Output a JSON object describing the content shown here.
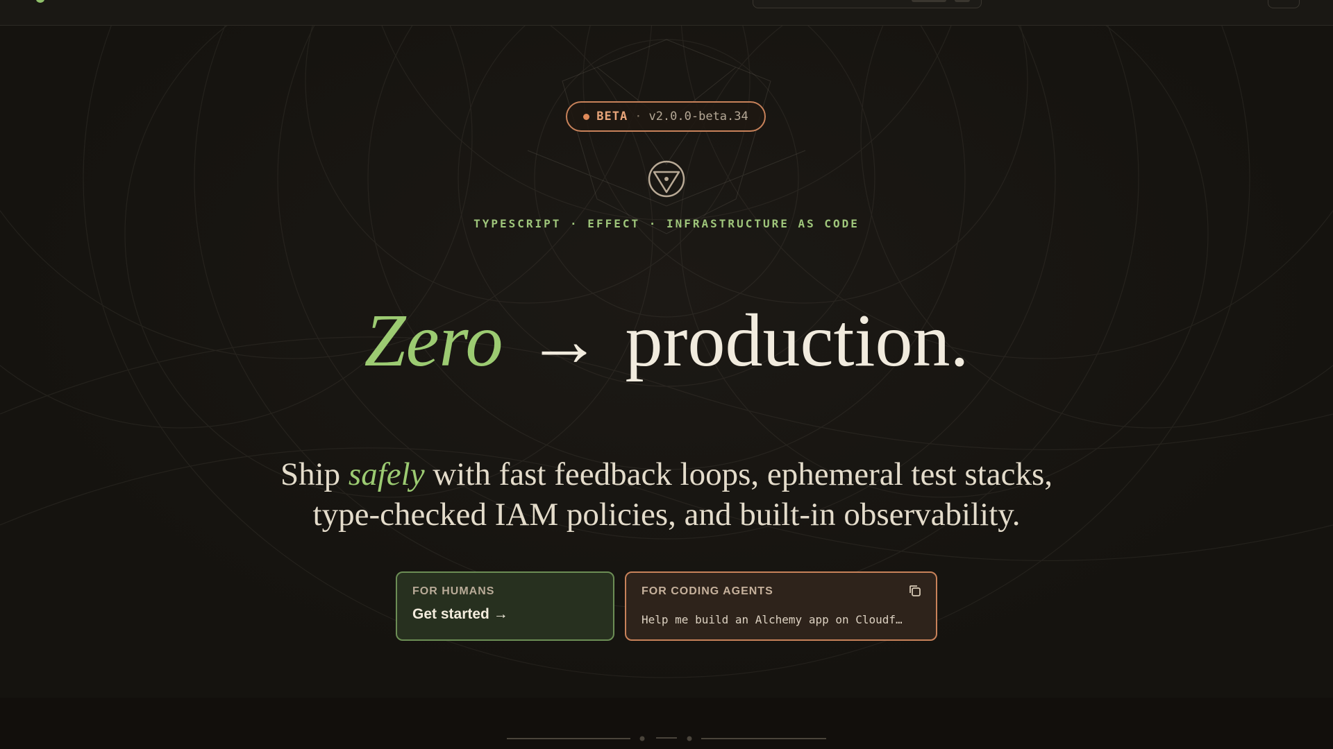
{
  "badge": {
    "label": "BETA",
    "separator": "·",
    "version": "v2.0.0-beta.34"
  },
  "tagline": "TYPESCRIPT · EFFECT · INFRASTRUCTURE AS CODE",
  "headline": {
    "accent": "Zero",
    "arrow": "→",
    "rest": "production."
  },
  "subheadline": {
    "before": "Ship ",
    "accent": "safely",
    "line1_after": " with fast feedback loops, ephemeral test stacks,",
    "line2": "type-checked IAM policies, and built-in observability."
  },
  "cards": {
    "humans": {
      "kicker": "FOR HUMANS",
      "cta": "Get started →"
    },
    "agents": {
      "kicker": "FOR CODING AGENTS",
      "prompt": "Help me build an Alchemy app on Cloudf…",
      "icon": "copy-icon"
    }
  },
  "colors": {
    "accent_green": "#9ccb72",
    "accent_copper": "#c8825a",
    "background": "#15130f"
  }
}
